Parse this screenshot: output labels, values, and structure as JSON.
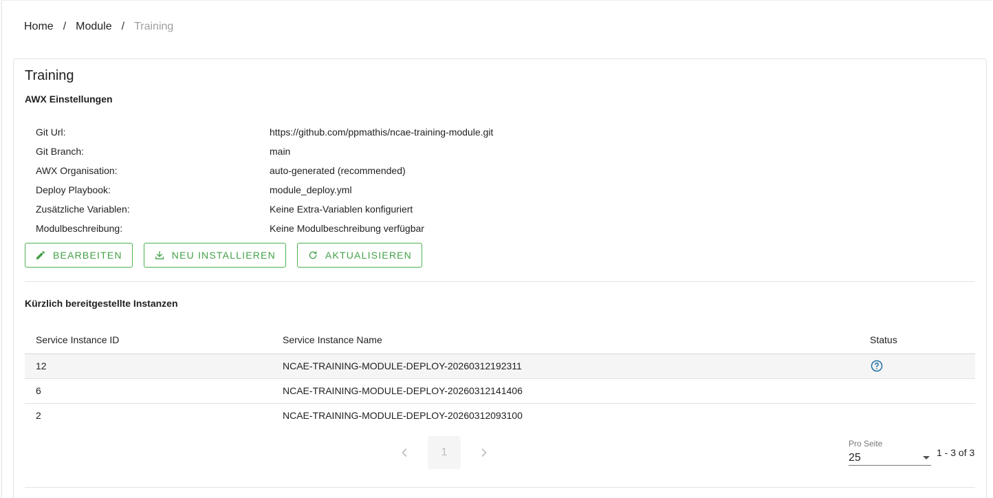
{
  "breadcrumb": {
    "items": [
      "Home",
      "Module"
    ],
    "separator": "/",
    "current": "Training"
  },
  "card": {
    "title": "Training",
    "settings_title": "AWX Einstellungen",
    "settings": [
      {
        "key": "Git Url:",
        "value": "https://github.com/ppmathis/ncae-training-module.git"
      },
      {
        "key": "Git Branch:",
        "value": "main"
      },
      {
        "key": "AWX Organisation:",
        "value": "auto-generated (recommended)"
      },
      {
        "key": "Deploy Playbook:",
        "value": "module_deploy.yml"
      },
      {
        "key": "Zusätzliche Variablen:",
        "value": "Keine Extra-Variablen konfiguriert"
      },
      {
        "key": "Modulbeschreibung:",
        "value": "Keine Modulbeschreibung verfügbar"
      }
    ],
    "actions": {
      "edit": "BEARBEITEN",
      "reinstall": "NEU INSTALLIEREN",
      "update": "AKTUALISIEREN"
    },
    "instances_title": "Kürzlich bereitgestellte Instanzen",
    "table": {
      "headers": [
        "Service Instance ID",
        "Service Instance Name",
        "Status"
      ],
      "rows": [
        {
          "id": "12",
          "name": "NCAE-TRAINING-MODULE-DEPLOY-20260312192311",
          "status_icon": "help-circle-icon"
        },
        {
          "id": "6",
          "name": "NCAE-TRAINING-MODULE-DEPLOY-20260312141406",
          "status_icon": ""
        },
        {
          "id": "2",
          "name": "NCAE-TRAINING-MODULE-DEPLOY-20260312093100",
          "status_icon": ""
        }
      ]
    },
    "pagination": {
      "current_page": "1",
      "per_page_label": "Pro Seite",
      "per_page_value": "25",
      "range": "1 - 3 of 3"
    }
  },
  "colors": {
    "accent": "#43a047",
    "status_icon": "#1e6fa8",
    "muted": "#9e9e9e"
  }
}
